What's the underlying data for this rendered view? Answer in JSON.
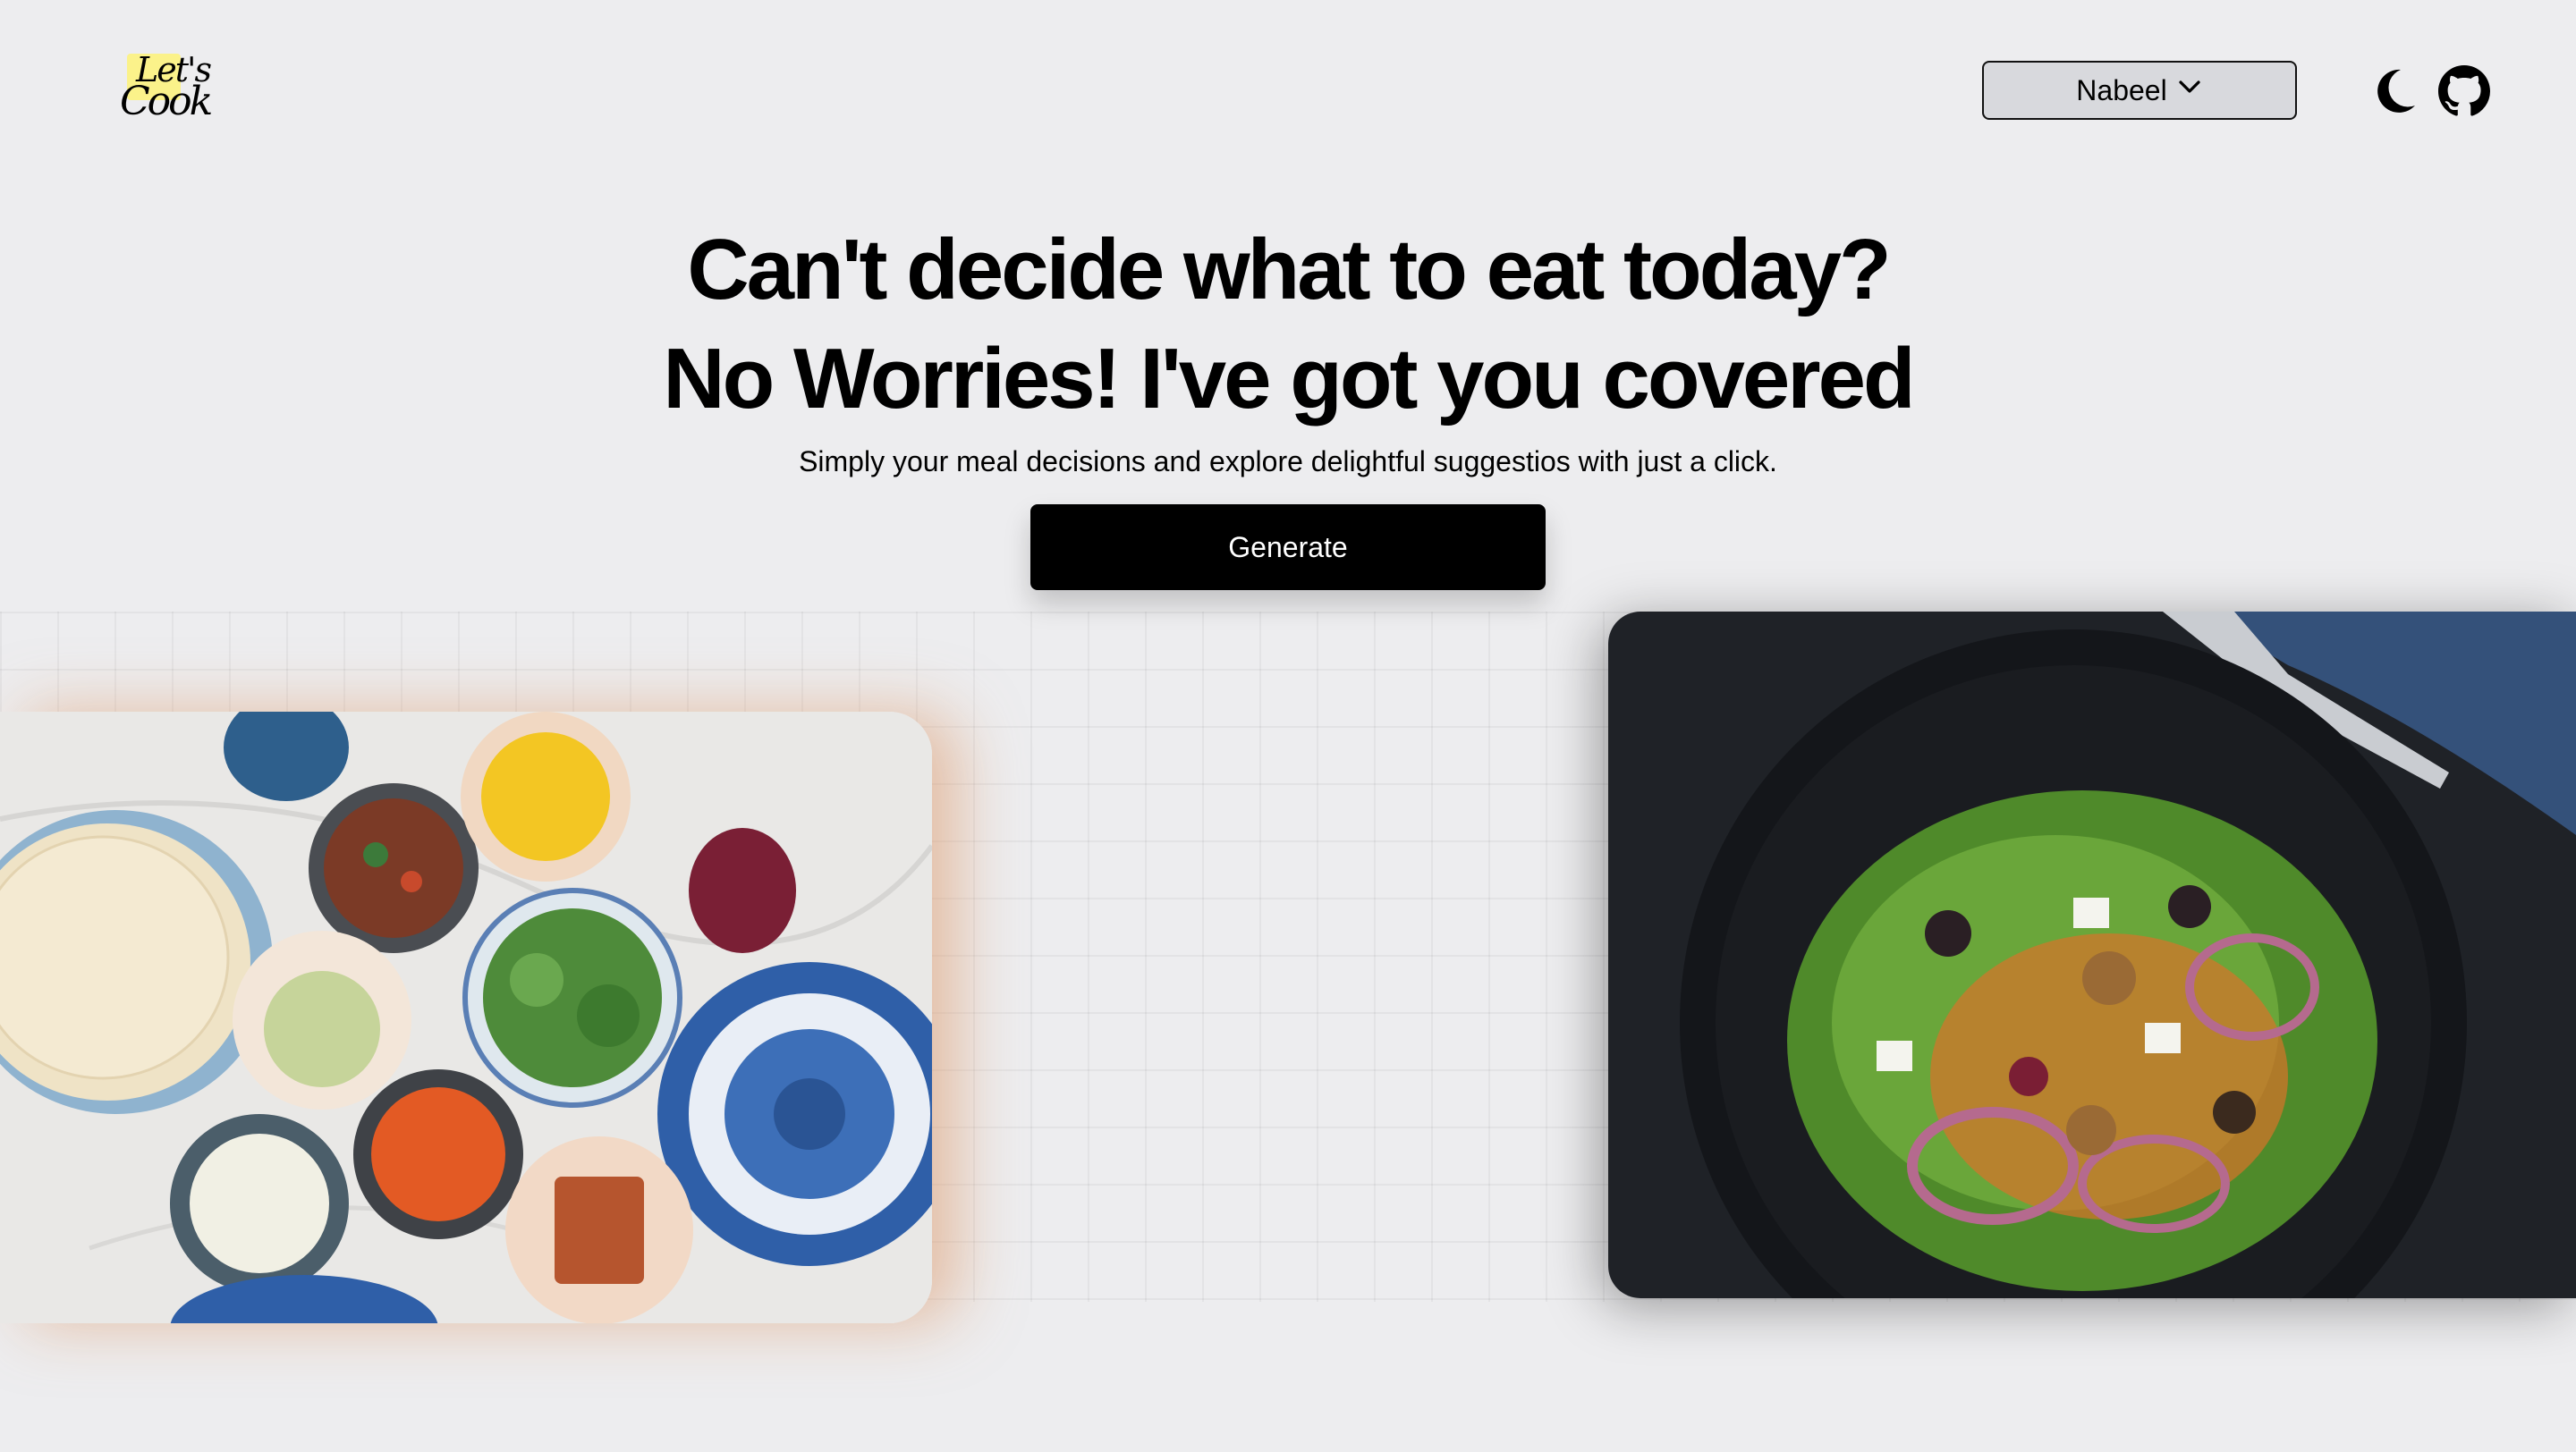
{
  "header": {
    "logo": {
      "line1": "Let's",
      "line2": "Cook"
    },
    "user_menu": {
      "label": "Nabeel",
      "icon": "chevron-down-icon"
    },
    "theme_toggle": {
      "icon": "moon-icon"
    },
    "github_link": {
      "icon": "github-icon"
    }
  },
  "hero": {
    "title_line1": "Can't decide what to eat today?",
    "title_line2": "No Worries! I've got you covered",
    "subtitle": "Simply your meal decisions and explore delightful suggestios with just a click.",
    "generate_button": "Generate"
  },
  "images": {
    "left": "food-spread-photo",
    "right": "salad-plate-photo"
  },
  "colors": {
    "background": "#ededef",
    "button_bg": "#000000",
    "user_menu_bg": "#d8d9dd",
    "left_glow": "#dc9664"
  }
}
